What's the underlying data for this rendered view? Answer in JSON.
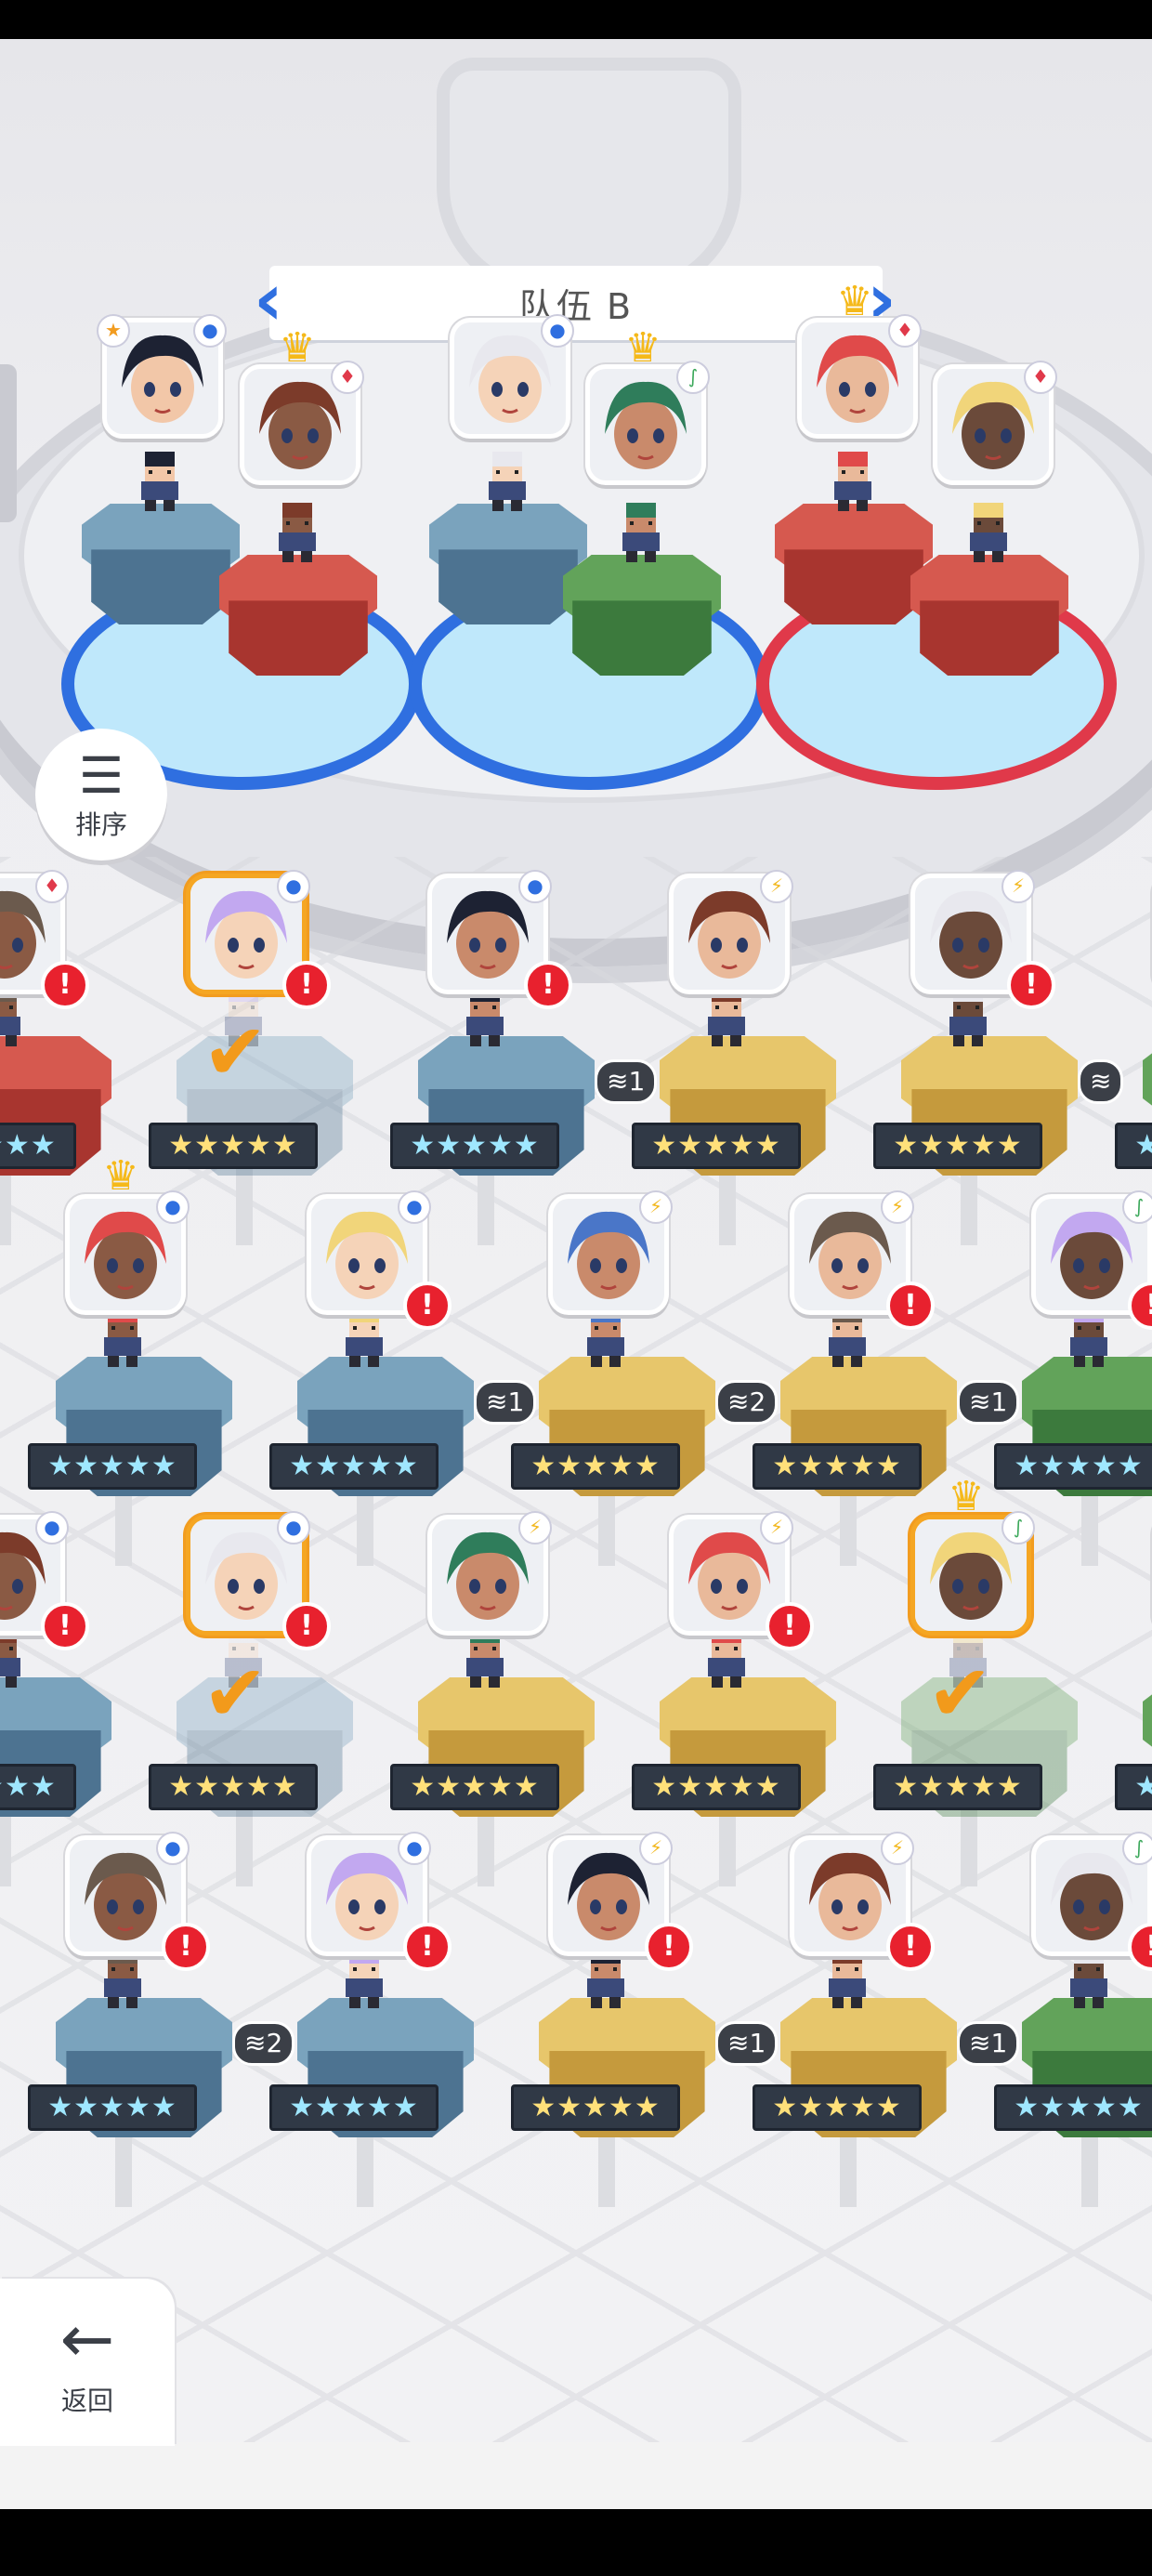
{
  "header": {
    "team_name": "队伍 B"
  },
  "controls": {
    "sort_label": "排序",
    "back_label": "返回"
  },
  "colors": {
    "accent_arrow": "#2f6fe0",
    "alert_red": "#e8212e",
    "selected_orange": "#f29c1f",
    "star_text": "#9fe7ff"
  },
  "formation": {
    "slots": [
      {
        "ring_color": "#2f6fe0",
        "leader_icon": "star-icon",
        "members": [
          {
            "attribute_icon": "circle-icon",
            "pedestal": "blue"
          },
          {
            "attribute_icon": "diamond-icon",
            "pedestal": "red",
            "crown": true
          }
        ]
      },
      {
        "ring_color": "#2f6fe0",
        "members": [
          {
            "attribute_icon": "circle-icon",
            "pedestal": "blue"
          },
          {
            "attribute_icon": "leaf-icon",
            "pedestal": "green",
            "crown": true
          }
        ]
      },
      {
        "ring_color": "#e0394a",
        "members": [
          {
            "attribute_icon": "diamond-icon",
            "pedestal": "red",
            "crown": true
          },
          {
            "attribute_icon": "diamond-icon",
            "pedestal": "red"
          }
        ]
      }
    ]
  },
  "roster": {
    "stars": "★★★★★",
    "rows": [
      [
        {
          "attr": "♦",
          "ped": "red",
          "alert": true,
          "partial": "left"
        },
        {
          "attr": "●",
          "ped": "blue",
          "alert": true,
          "selected": true,
          "in_team": true
        },
        {
          "attr": "●",
          "ped": "blue",
          "alert": true
        },
        {
          "attr": "⚡",
          "ped": "gold",
          "level": "1"
        },
        {
          "attr": "⚡",
          "ped": "gold",
          "alert": true
        },
        {
          "attr": "",
          "ped": "green",
          "level": "",
          "partial": "right"
        }
      ],
      [
        {
          "attr": "●",
          "ped": "blue",
          "crown": true
        },
        {
          "attr": "●",
          "ped": "blue",
          "alert": true
        },
        {
          "attr": "⚡",
          "ped": "gold",
          "level": "1"
        },
        {
          "attr": "⚡",
          "ped": "gold",
          "alert": true,
          "level": "2"
        },
        {
          "attr": "∫",
          "ped": "green",
          "alert": true,
          "level": "1"
        }
      ],
      [
        {
          "attr": "●",
          "ped": "blue",
          "alert": true,
          "partial": "left"
        },
        {
          "attr": "●",
          "ped": "blue",
          "alert": true,
          "selected": true,
          "in_team": true
        },
        {
          "attr": "⚡",
          "ped": "gold"
        },
        {
          "attr": "⚡",
          "ped": "gold",
          "alert": true
        },
        {
          "attr": "∫",
          "ped": "green",
          "selected": true,
          "in_team": true,
          "crown": true
        },
        {
          "attr": "",
          "ped": "green",
          "partial": "right"
        }
      ],
      [
        {
          "attr": "●",
          "ped": "blue",
          "alert": true
        },
        {
          "attr": "●",
          "ped": "blue",
          "alert": true,
          "level": "2"
        },
        {
          "attr": "⚡",
          "ped": "gold",
          "alert": true
        },
        {
          "attr": "⚡",
          "ped": "gold",
          "alert": true,
          "level": "1"
        },
        {
          "attr": "∫",
          "ped": "green",
          "alert": true,
          "level": "1"
        }
      ]
    ]
  }
}
